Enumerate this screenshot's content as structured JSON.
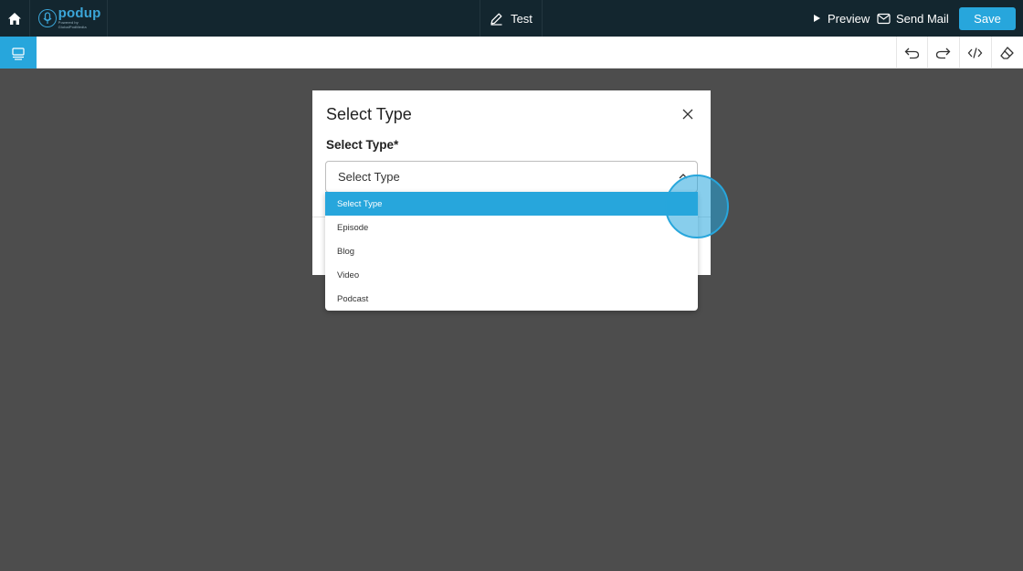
{
  "topbar": {
    "home_icon": "home-icon",
    "logo": {
      "text": "podup",
      "subtext": "Powered by GlobalPodMedia"
    },
    "doc_title": "Test",
    "preview_label": "Preview",
    "send_mail_label": "Send Mail",
    "save_label": "Save"
  },
  "toolbar": {
    "tools": [
      "undo-icon",
      "redo-icon",
      "code-icon",
      "eraser-icon"
    ]
  },
  "modal": {
    "title": "Select Type",
    "field_label": "Select Type*",
    "select_value": "Select Type",
    "options": [
      "Select Type",
      "Episode",
      "Blog",
      "Video",
      "Podcast"
    ],
    "selected_index": 0
  },
  "colors": {
    "topbar_bg": "#13262f",
    "accent": "#27a6dc",
    "canvas_bg": "#4d4d4d"
  }
}
